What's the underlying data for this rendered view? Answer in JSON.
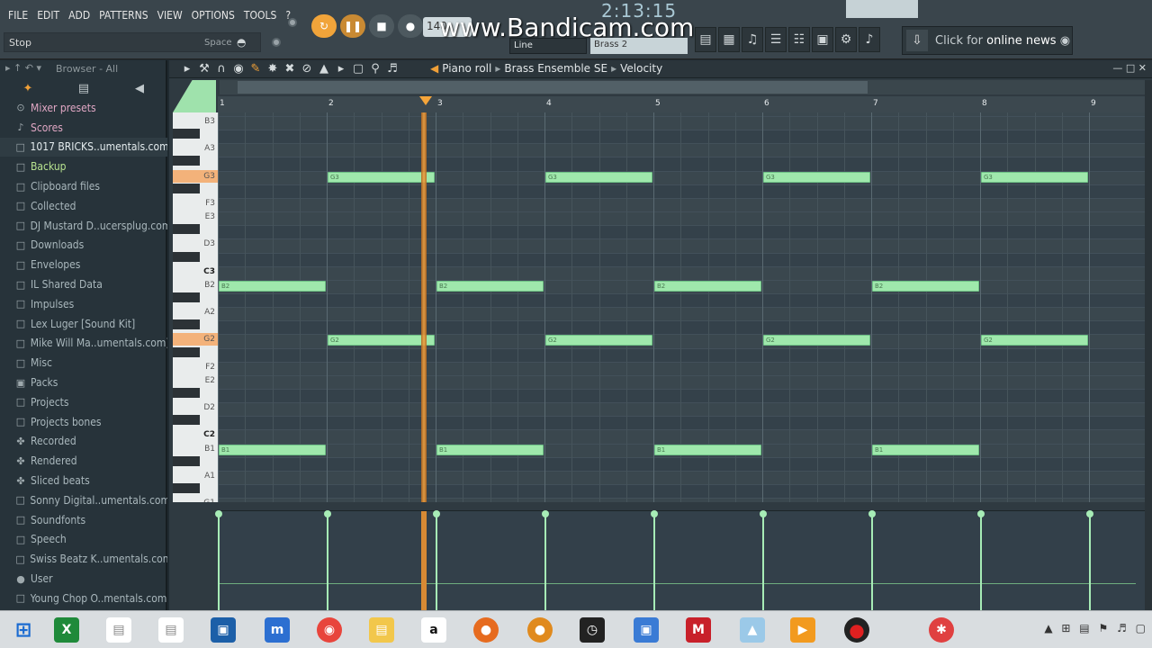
{
  "menu": [
    "FILE",
    "EDIT",
    "ADD",
    "PATTERNS",
    "VIEW",
    "OPTIONS",
    "TOOLS",
    "?"
  ],
  "hint": {
    "text": "Stop",
    "shortcut": "Space"
  },
  "tempo": "140",
  "watermark": "www.Bandicam.com",
  "time": "2:13:15",
  "snap": "Line",
  "pattern_field": "Brass 2",
  "news": {
    "prefix": "Click for ",
    "highlight": "online news"
  },
  "browser": {
    "title": "Browser - All",
    "items": [
      {
        "label": "Mixer presets",
        "icon": "mixer-icon"
      },
      {
        "label": "Scores",
        "icon": "note-icon"
      },
      {
        "label": "1017 BRICKS..umentals.com)",
        "icon": "folder-icon"
      },
      {
        "label": "Backup",
        "icon": "folder-icon"
      },
      {
        "label": "Clipboard files",
        "icon": "folder-icon"
      },
      {
        "label": "Collected",
        "icon": "folder-icon"
      },
      {
        "label": "DJ Mustard D..ucersplug.com",
        "icon": "folder-icon"
      },
      {
        "label": "Downloads",
        "icon": "folder-icon"
      },
      {
        "label": "Envelopes",
        "icon": "folder-icon"
      },
      {
        "label": "IL Shared Data",
        "icon": "folder-icon"
      },
      {
        "label": "Impulses",
        "icon": "folder-icon"
      },
      {
        "label": "Lex Luger [Sound Kit]",
        "icon": "folder-icon"
      },
      {
        "label": "Mike Will Ma..umentals.com)",
        "icon": "folder-icon"
      },
      {
        "label": "Misc",
        "icon": "folder-icon"
      },
      {
        "label": "Packs",
        "icon": "packs-icon"
      },
      {
        "label": "Projects",
        "icon": "folder-icon"
      },
      {
        "label": "Projects bones",
        "icon": "folder-icon"
      },
      {
        "label": "Recorded",
        "icon": "wave-icon"
      },
      {
        "label": "Rendered",
        "icon": "wave-icon"
      },
      {
        "label": "Sliced beats",
        "icon": "wave-icon"
      },
      {
        "label": "Sonny Digital..umentals.com)",
        "icon": "folder-icon"
      },
      {
        "label": "Soundfonts",
        "icon": "folder-icon"
      },
      {
        "label": "Speech",
        "icon": "folder-icon"
      },
      {
        "label": "Swiss Beatz K..umentals.com)",
        "icon": "folder-icon"
      },
      {
        "label": "User",
        "icon": "user-icon"
      },
      {
        "label": "Young Chop O..mentals.com)",
        "icon": "folder-icon"
      }
    ]
  },
  "pianoroll": {
    "title_parts": [
      "Piano roll",
      "Brass Ensemble SE",
      "Velocity"
    ],
    "bars": [
      "1",
      "2",
      "3",
      "4",
      "5",
      "6",
      "7",
      "8",
      "9"
    ],
    "key_labels": [
      "B3",
      "A3",
      "G3",
      "F3",
      "E3",
      "D3",
      "C3",
      "B2",
      "A2",
      "G2",
      "F2",
      "E2",
      "D2",
      "C2",
      "B1",
      "A1",
      "G1"
    ],
    "notes": [
      {
        "pitch": "G3",
        "bar": 2
      },
      {
        "pitch": "G3",
        "bar": 4
      },
      {
        "pitch": "G3",
        "bar": 6
      },
      {
        "pitch": "G3",
        "bar": 8
      },
      {
        "pitch": "B2",
        "bar": 1
      },
      {
        "pitch": "B2",
        "bar": 3
      },
      {
        "pitch": "B2",
        "bar": 5
      },
      {
        "pitch": "B2",
        "bar": 7
      },
      {
        "pitch": "G2",
        "bar": 2
      },
      {
        "pitch": "G2",
        "bar": 4
      },
      {
        "pitch": "G2",
        "bar": 6
      },
      {
        "pitch": "G2",
        "bar": 8
      },
      {
        "pitch": "B1",
        "bar": 1
      },
      {
        "pitch": "B1",
        "bar": 3
      },
      {
        "pitch": "B1",
        "bar": 5
      },
      {
        "pitch": "B1",
        "bar": 7
      }
    ]
  }
}
